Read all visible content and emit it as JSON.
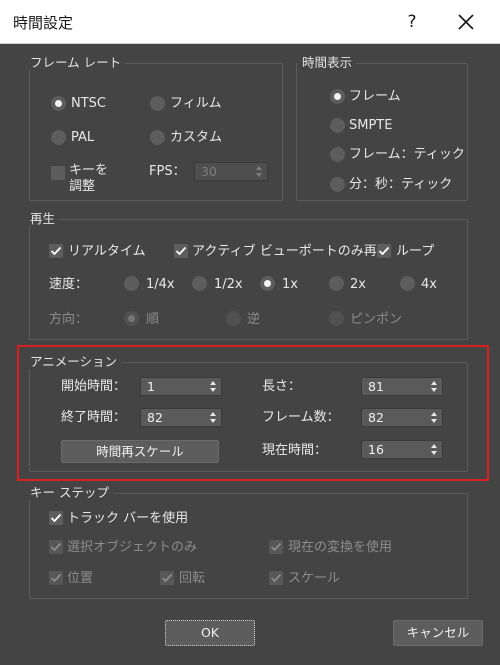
{
  "window": {
    "title": "時間設定",
    "help_label": "?"
  },
  "frame_rate": {
    "legend": "フレーム レート",
    "options": [
      {
        "label": "NTSC",
        "selected": true
      },
      {
        "label": "フィルム",
        "selected": false
      },
      {
        "label": "PAL",
        "selected": false
      },
      {
        "label": "カスタム",
        "selected": false
      }
    ],
    "adjust_keys": {
      "label_line1": "キーを",
      "label_line2": "調整",
      "checked": false
    },
    "fps": {
      "label": "FPS：",
      "value": "30",
      "enabled": false
    }
  },
  "time_display": {
    "legend": "時間表示",
    "options": [
      {
        "label": "フレーム",
        "selected": true
      },
      {
        "label": "SMPTE",
        "selected": false
      },
      {
        "label": "フレーム：ティック",
        "selected": false
      },
      {
        "label": "分：秒：ティック",
        "selected": false
      }
    ]
  },
  "playback": {
    "legend": "再生",
    "realtime": {
      "label": "リアルタイム",
      "checked": true
    },
    "active_viewport_only": {
      "label": "アクティブ ビューポートのみ再生",
      "checked": true
    },
    "loop": {
      "label": "ループ",
      "checked": true
    },
    "speed": {
      "label": "速度：",
      "options": [
        {
          "label": "1/4x",
          "selected": false
        },
        {
          "label": "1/2x",
          "selected": false
        },
        {
          "label": "1x",
          "selected": true
        },
        {
          "label": "2x",
          "selected": false
        },
        {
          "label": "4x",
          "selected": false
        }
      ]
    },
    "direction": {
      "label": "方向：",
      "enabled": false,
      "options": [
        {
          "label": "順",
          "selected": true
        },
        {
          "label": "逆",
          "selected": false
        },
        {
          "label": "ピンポン",
          "selected": false
        }
      ]
    }
  },
  "animation": {
    "legend": "アニメーション",
    "start_time": {
      "label": "開始時間：",
      "value": "1"
    },
    "end_time": {
      "label": "終了時間：",
      "value": "82"
    },
    "length": {
      "label": "長さ：",
      "value": "81"
    },
    "frame_count": {
      "label": "フレーム数：",
      "value": "82"
    },
    "current_time": {
      "label": "現在時間：",
      "value": "16"
    },
    "rescale_button": "時間再スケール",
    "highlight_color": "#d92020"
  },
  "key_steps": {
    "legend": "キー ステップ",
    "use_trackbar": {
      "label": "トラック バーを使用",
      "checked": true
    },
    "selected_objects_only": {
      "label": "選択オブジェクトのみ",
      "checked": true,
      "enabled": false
    },
    "use_current_transform": {
      "label": "現在の変換を使用",
      "checked": true,
      "enabled": false
    },
    "position": {
      "label": "位置",
      "checked": true,
      "enabled": false
    },
    "rotation": {
      "label": "回転",
      "checked": true,
      "enabled": false
    },
    "scale": {
      "label": "スケール",
      "checked": true,
      "enabled": false
    }
  },
  "footer": {
    "ok_label": "OK",
    "cancel_label": "キャンセル"
  }
}
